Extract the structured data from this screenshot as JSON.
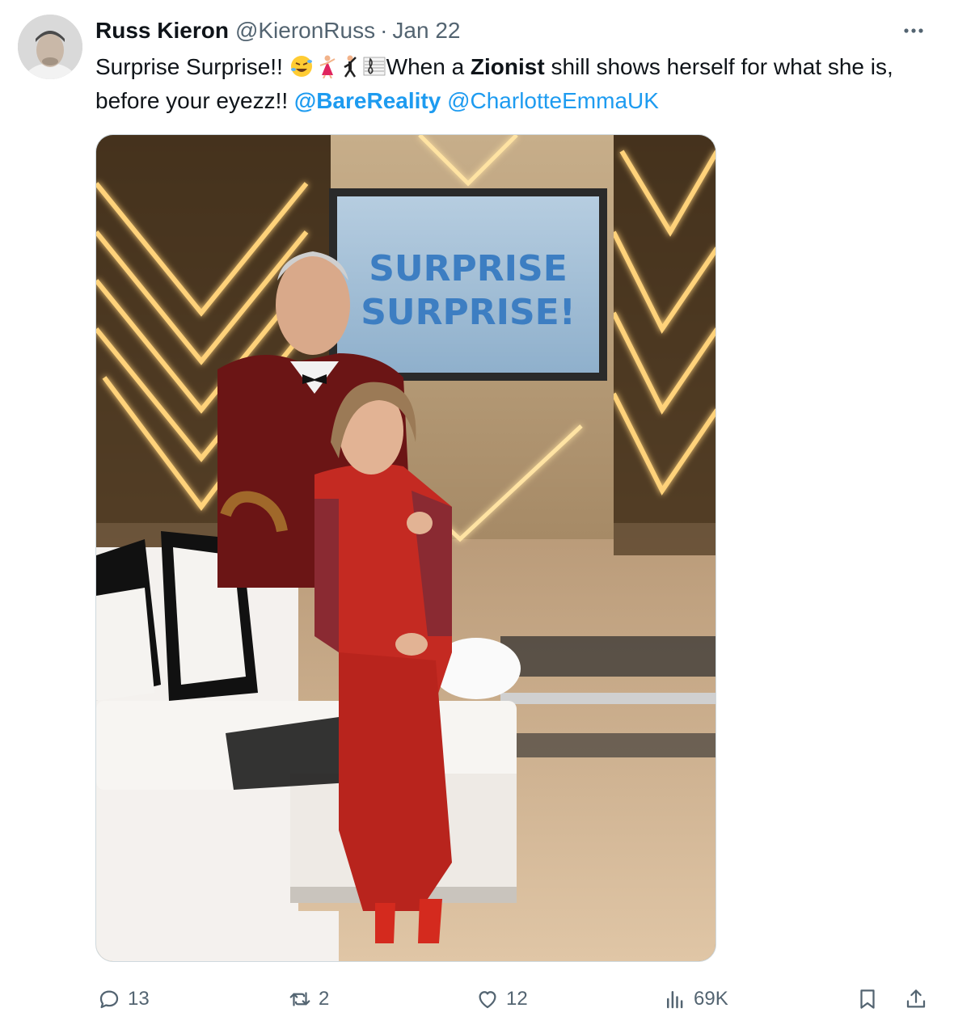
{
  "author": {
    "name": "Russ Kieron",
    "handle": "@KieronRuss",
    "separator": "·",
    "date": "Jan 22",
    "avatar_icon": "profile-photo"
  },
  "tweet": {
    "text_start": "Surprise Surprise!! ",
    "emojis": [
      "rolling-on-floor-laughing",
      "dancing-woman",
      "dancing-man",
      "musical-score"
    ],
    "text_when": "When a ",
    "text_bold": "Zionist",
    "text_rest": " shill shows herself for what she is, before your eyezz!! ",
    "mention_1": "@BareReality",
    "mention_gap": " ",
    "mention_2": "@CharlotteEmmaUK"
  },
  "media": {
    "screen_line_1": "SURPRISE",
    "screen_line_2": "SURPRISE!"
  },
  "actions": {
    "replies": "13",
    "reposts": "2",
    "likes": "12",
    "views": "69K"
  },
  "colors": {
    "text": "#0f1419",
    "secondary": "#536471",
    "link": "#1d9bf0",
    "dress": "#c42a22",
    "jacket": "#6b1515"
  }
}
